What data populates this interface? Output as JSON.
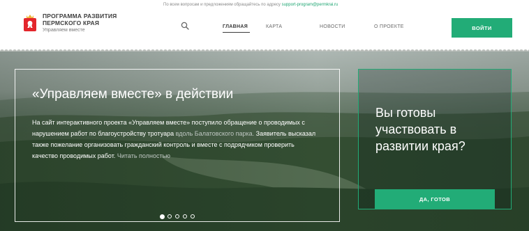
{
  "header": {
    "notice_text": "По всем вопросам и предложениям обращайтесь по адресу",
    "notice_email": "support-program@permkrai.ru",
    "brand_line1": "ПРОГРАММА РАЗВИТИЯ",
    "brand_line2": "ПЕРМСКОГО КРАЯ",
    "brand_subtitle": "Управляем вместе",
    "nav": [
      {
        "label": "ГЛАВНАЯ"
      },
      {
        "label": "КАРТА"
      },
      {
        "label": "НОВОСТИ"
      },
      {
        "label": "О ПРОЕКТЕ"
      }
    ],
    "login_label": "ВОЙТИ"
  },
  "hero": {
    "news_title": "«Управляем вместе» в действии",
    "news_text_main": "На сайт интерактивного проекта «Управляем вместе» поступило обращение о проводимых с нарушением работ по благоустройству тротуара",
    "news_text_muted": "вдоль Балатовского парка.",
    "news_text_rest": "Заявитель высказал также пожелание организовать гражданский контроль и вместе с подрядчиком проверить качество проводимых работ.",
    "read_more": "Читать полностью",
    "cta_title": "Вы готовы участвовать в развитии края?",
    "cta_button": "ДА, ГОТОВ"
  },
  "slider": {
    "total": 5,
    "active": 1
  },
  "colors": {
    "accent": "#22ac77",
    "logo_red": "#e3262c"
  }
}
